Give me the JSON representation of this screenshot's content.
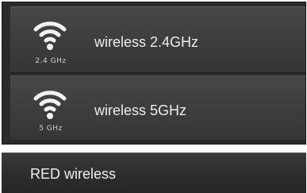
{
  "networks": {
    "band_24": {
      "label": "wireless 2.4GHz",
      "band_badge": "2.4 GHz",
      "icon": "wifi-icon"
    },
    "band_5": {
      "label": "wireless 5GHz",
      "band_badge": "5 GHz",
      "icon": "wifi-icon"
    }
  },
  "selected": {
    "label": "RED wireless"
  },
  "colors": {
    "panel_bg": "#2a2a2a",
    "row_bg": "#404040",
    "text": "#ececec",
    "icon": "#f2f2f2"
  }
}
